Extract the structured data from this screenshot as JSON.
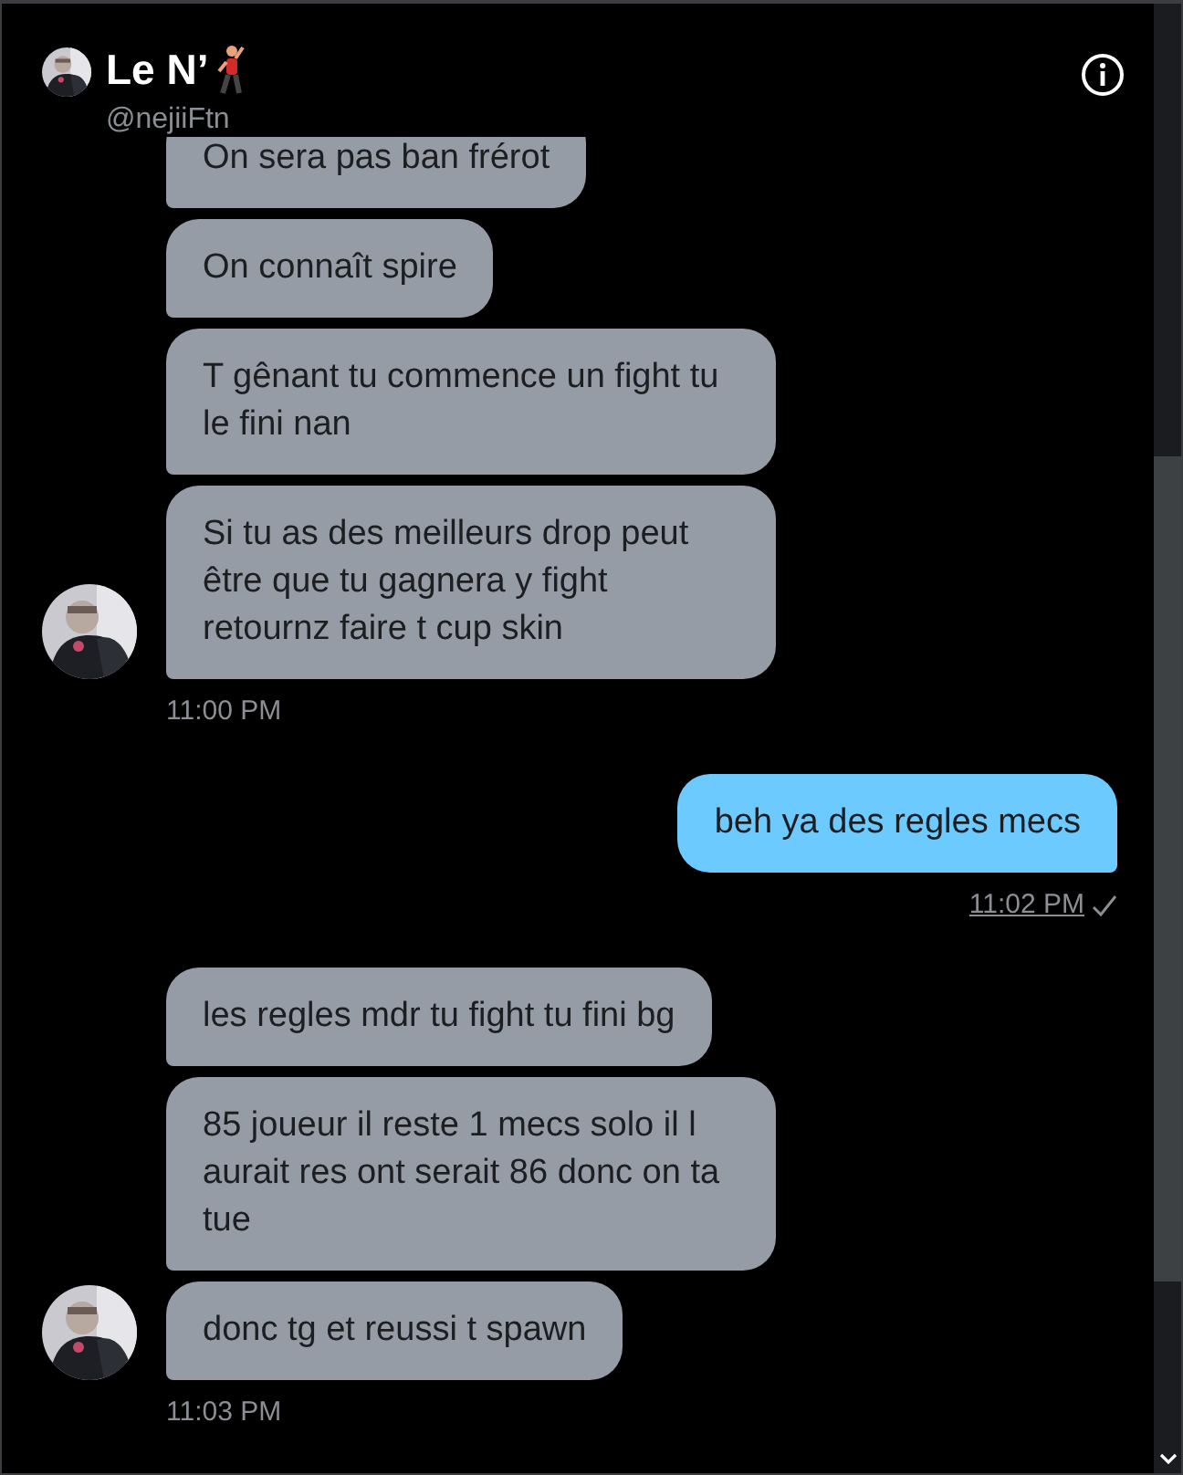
{
  "header": {
    "name": "Le N’",
    "handle": "@nejiiFtn"
  },
  "groups": [
    {
      "kind": "received",
      "messages": [
        "On sera pas ban frérot",
        "On connaît spire",
        "T gênant tu commence un fight tu le fini nan",
        "Si tu as des meilleurs drop peut être que tu gagnera y fight retournz faire t cup skin"
      ],
      "time": "11:00 PM"
    },
    {
      "kind": "sent",
      "messages": [
        "beh ya des regles mecs"
      ],
      "time": "11:02 PM",
      "read": true
    },
    {
      "kind": "received",
      "messages": [
        "les regles mdr tu fight tu fini bg",
        "85 joueur il reste 1 mecs solo il l aurait res ont serait 86 donc on ta tue",
        "donc tg et reussi t spawn"
      ],
      "time": "11:03 PM"
    }
  ]
}
